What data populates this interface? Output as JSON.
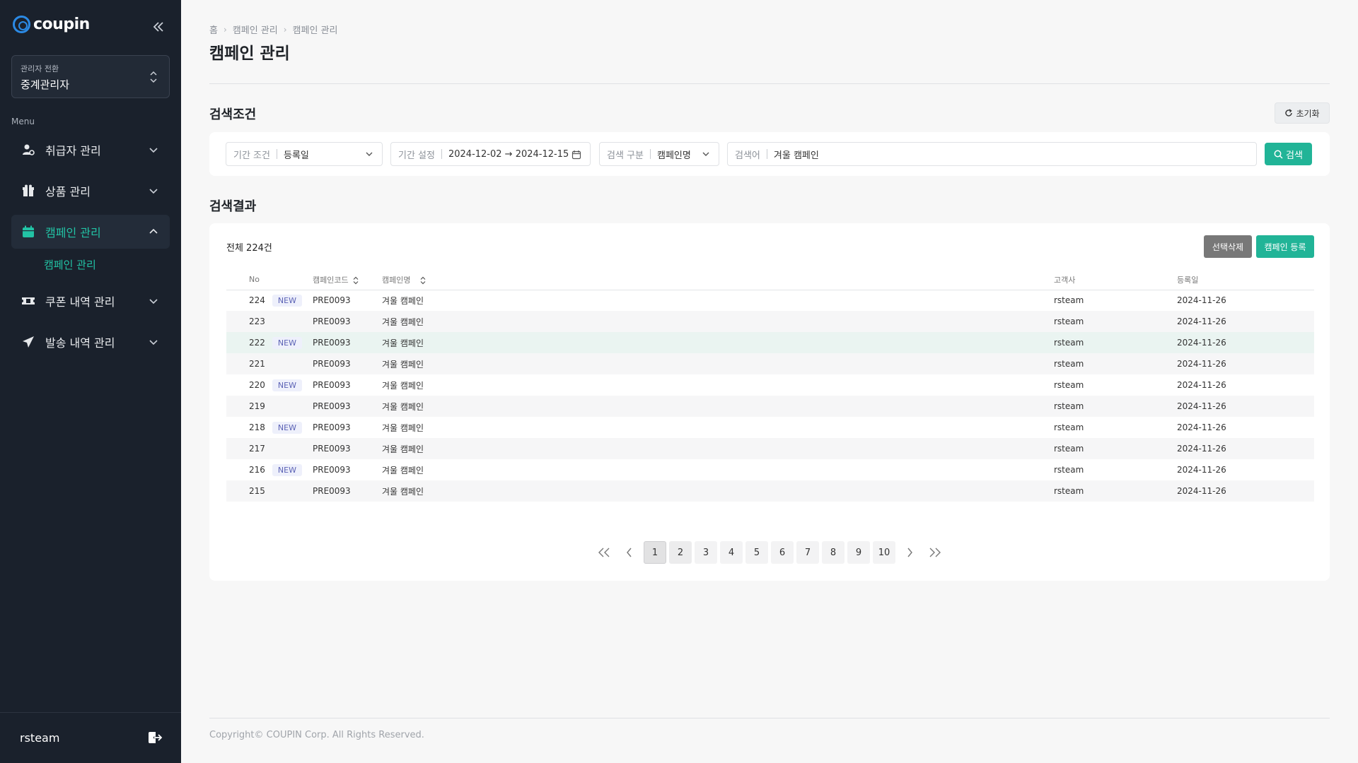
{
  "brand": {
    "name": "coupin",
    "accent": "#21b497",
    "logo_color": "#2b8ae5"
  },
  "sidebar": {
    "role_switch": {
      "label": "관리자 전환",
      "value": "중계관리자"
    },
    "menu_label": "Menu",
    "items": [
      {
        "label": "취급자 관리",
        "icon": "user-gear-icon",
        "expanded": false
      },
      {
        "label": "상품 관리",
        "icon": "gift-box-icon",
        "expanded": false
      },
      {
        "label": "캠페인 관리",
        "icon": "calendar-icon",
        "expanded": true,
        "active": true
      },
      {
        "label": "쿠폰 내역 관리",
        "icon": "ticket-icon",
        "expanded": false
      },
      {
        "label": "발송 내역 관리",
        "icon": "send-icon",
        "expanded": false
      }
    ],
    "submenu": {
      "label": "캠페인 관리"
    },
    "user": "rsteam"
  },
  "breadcrumb": [
    "홈",
    "캠페인 관리",
    "캠페인 관리"
  ],
  "page_title": "캠페인 관리",
  "search": {
    "title": "검색조건",
    "reset_label": "초기화",
    "period_condition": {
      "label": "기간 조건",
      "value": "등록일"
    },
    "period": {
      "label": "기간 설정",
      "value": "2024-12-02 → 2024-12-15"
    },
    "search_type": {
      "label": "검색 구분",
      "value": "캠페인명"
    },
    "keyword": {
      "label": "검색어",
      "value": "겨울 캠페인"
    },
    "search_button": "검색"
  },
  "results": {
    "title": "검색결과",
    "total": "전체 224건",
    "delete_button": "선택삭제",
    "register_button": "캠페인 등록",
    "columns": {
      "no": "No",
      "code": "캠페인코드",
      "name": "캠페인명",
      "client": "고객사",
      "date": "등록일"
    },
    "new_label": "NEW",
    "rows": [
      {
        "no": "224",
        "new": true,
        "code": "PRE0093",
        "name": "겨울 캠페인",
        "client": "rsteam",
        "date": "2024-11-26"
      },
      {
        "no": "223",
        "new": false,
        "code": "PRE0093",
        "name": "겨울 캠페인",
        "client": "rsteam",
        "date": "2024-11-26"
      },
      {
        "no": "222",
        "new": true,
        "code": "PRE0093",
        "name": "겨울 캠페인",
        "client": "rsteam",
        "date": "2024-11-26"
      },
      {
        "no": "221",
        "new": false,
        "code": "PRE0093",
        "name": "겨울 캠페인",
        "client": "rsteam",
        "date": "2024-11-26"
      },
      {
        "no": "220",
        "new": true,
        "code": "PRE0093",
        "name": "겨울 캠페인",
        "client": "rsteam",
        "date": "2024-11-26"
      },
      {
        "no": "219",
        "new": false,
        "code": "PRE0093",
        "name": "겨울 캠페인",
        "client": "rsteam",
        "date": "2024-11-26"
      },
      {
        "no": "218",
        "new": true,
        "code": "PRE0093",
        "name": "겨울 캠페인",
        "client": "rsteam",
        "date": "2024-11-26"
      },
      {
        "no": "217",
        "new": false,
        "code": "PRE0093",
        "name": "겨울 캠페인",
        "client": "rsteam",
        "date": "2024-11-26"
      },
      {
        "no": "216",
        "new": true,
        "code": "PRE0093",
        "name": "겨울 캠페인",
        "client": "rsteam",
        "date": "2024-11-26"
      },
      {
        "no": "215",
        "new": false,
        "code": "PRE0093",
        "name": "겨울 캠페인",
        "client": "rsteam",
        "date": "2024-11-26"
      }
    ]
  },
  "pagination": {
    "pages": [
      "1",
      "2",
      "3",
      "4",
      "5",
      "6",
      "7",
      "8",
      "9",
      "10"
    ],
    "current": "1"
  },
  "footer": {
    "copyright": "Copyright© COUPIN Corp. All Rights Reserved."
  }
}
